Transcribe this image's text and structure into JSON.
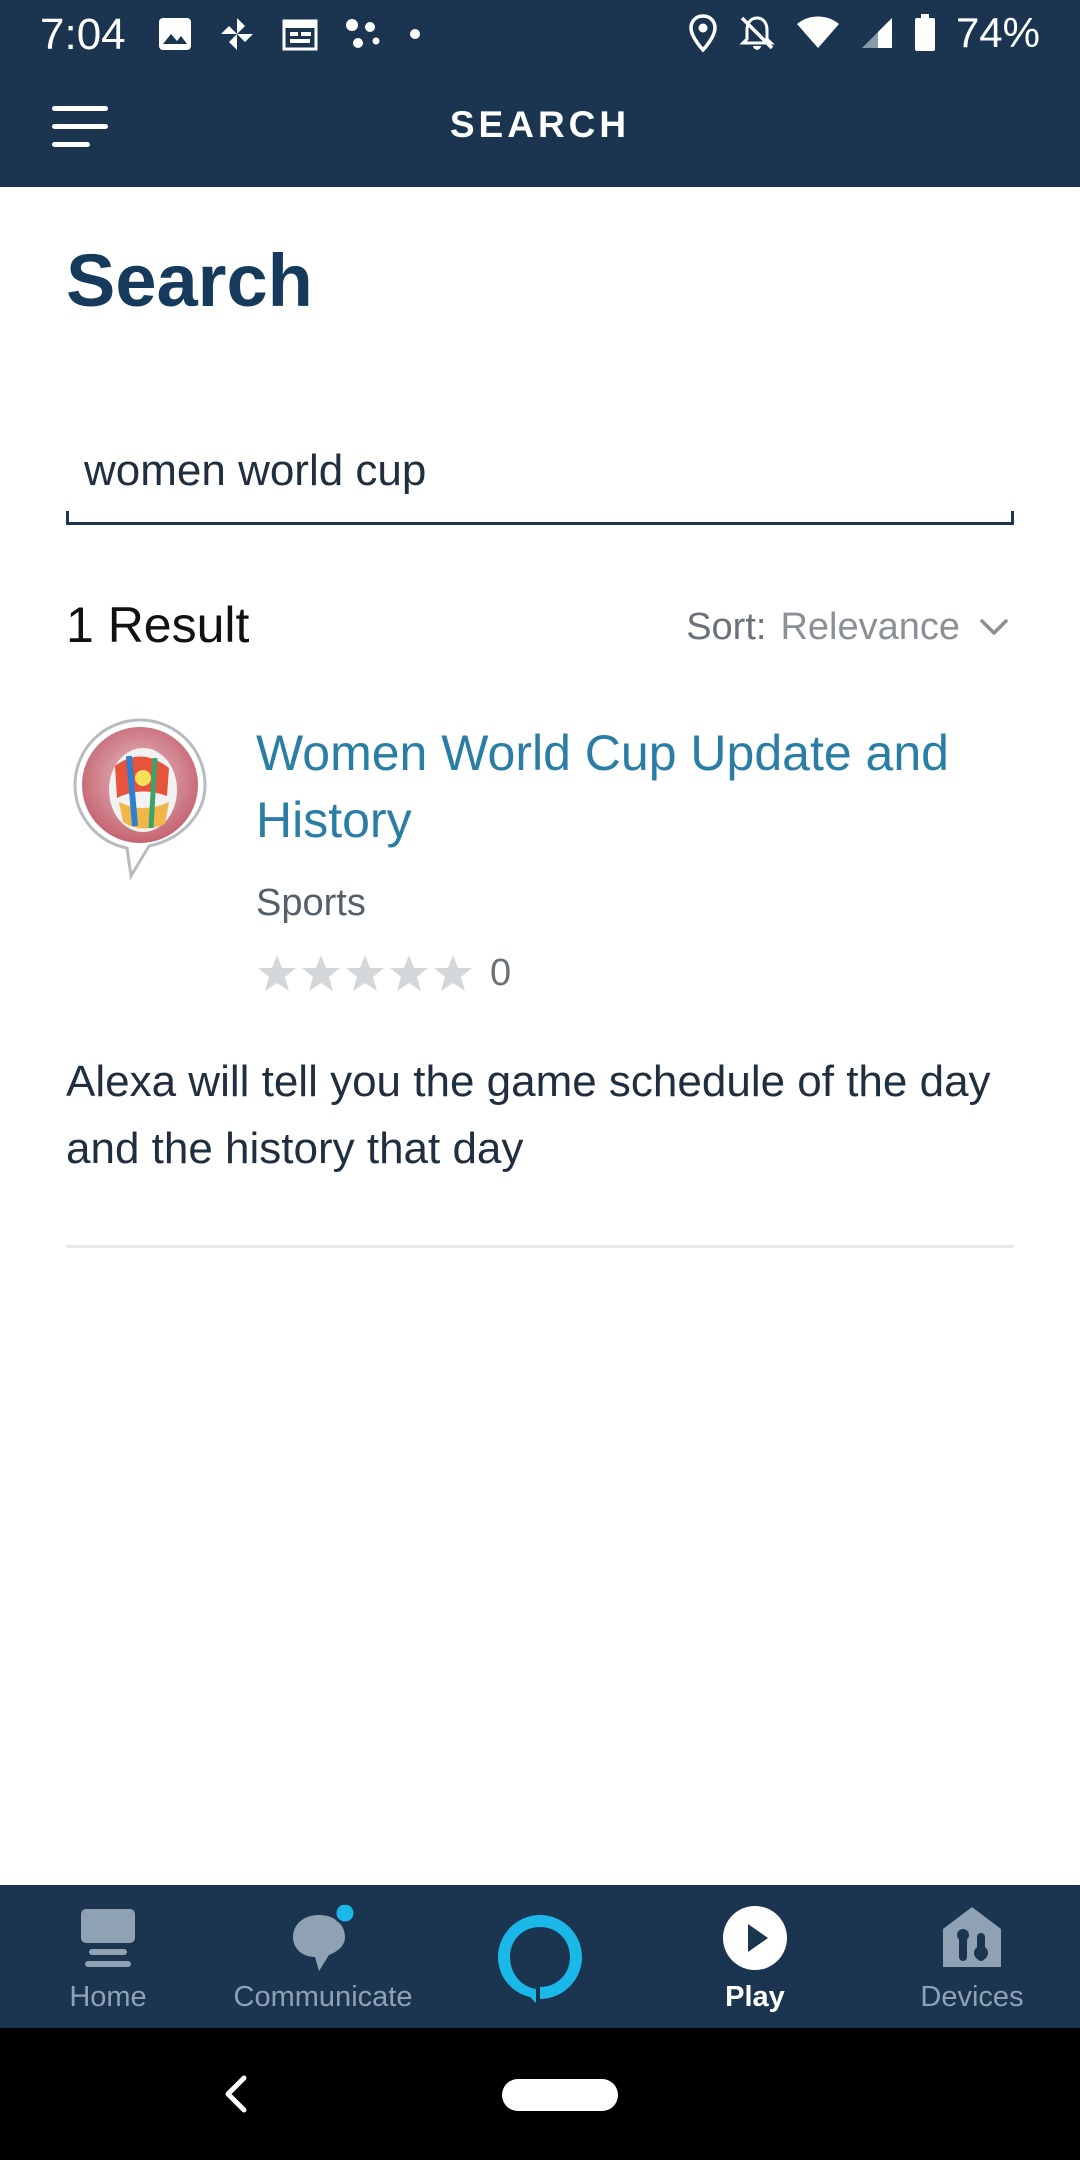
{
  "status_bar": {
    "time": "7:04",
    "battery": "74%",
    "left_icons": [
      "image-icon",
      "pinwheel-icon",
      "calendar-icon",
      "assistant-dots-icon",
      "dot-icon"
    ],
    "right_icons": [
      "location-icon",
      "bell-off-icon",
      "wifi-icon",
      "signal-icon",
      "battery-icon"
    ]
  },
  "header": {
    "title": "SEARCH",
    "menu_icon": "menu-icon"
  },
  "page": {
    "title": "Search"
  },
  "search": {
    "value": "women world cup",
    "placeholder": ""
  },
  "results": {
    "count_label": "1 Result",
    "sort_label": "Sort:",
    "sort_value": "Relevance",
    "items": [
      {
        "title": "Women World Cup Update and History",
        "category": "Sports",
        "rating_count": "0",
        "rating": 0,
        "description": "Alexa will tell you the game schedule of the day and the history that day"
      }
    ]
  },
  "bottom_nav": {
    "items": [
      {
        "label": "Home",
        "icon": "home-icon"
      },
      {
        "label": "Communicate",
        "icon": "chat-bubble-icon"
      },
      {
        "label": "",
        "icon": "alexa-ring-icon"
      },
      {
        "label": "Play",
        "icon": "play-icon",
        "active": true
      },
      {
        "label": "Devices",
        "icon": "devices-icon"
      }
    ]
  },
  "colors": {
    "header_bg": "#1b3550",
    "accent_blue": "#2a7ea6",
    "alexa_cyan": "#1ab8e8",
    "title_navy": "#153a5b"
  }
}
